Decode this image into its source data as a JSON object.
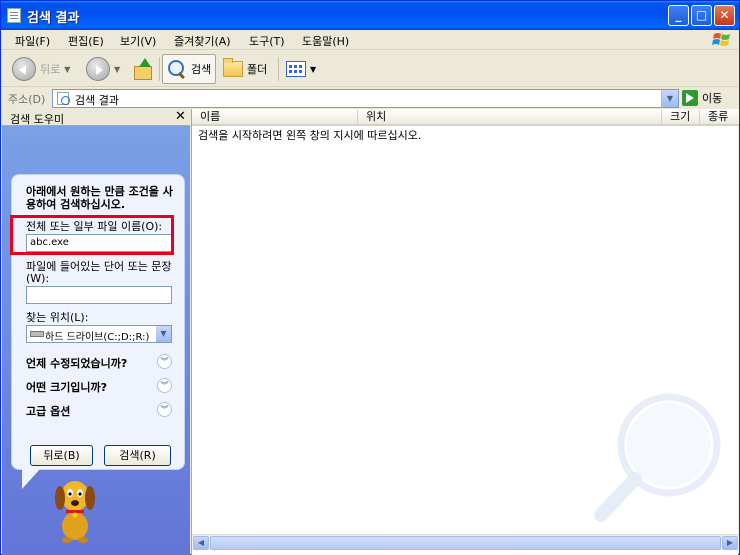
{
  "window": {
    "title": "검색 결과"
  },
  "menu": [
    "파일(F)",
    "편집(E)",
    "보기(V)",
    "즐겨찾기(A)",
    "도구(T)",
    "도움말(H)"
  ],
  "toolbar": {
    "back": "뒤로",
    "search": "검색",
    "folders": "폴더"
  },
  "address": {
    "label": "주소(D)",
    "value": "검색 결과",
    "go": "이동"
  },
  "left_pane": {
    "title": "검색 도우미",
    "close": "✕",
    "prompt": "아래에서 원하는 만큼 조건을 사용하여 검색하십시오.",
    "filename_label": "전체 또는 일부 파일 이름(O):",
    "filename_value": "abc.exe",
    "word_label": "파일에 들어있는 단어 또는 문장(W):",
    "word_value": "",
    "location_label": "찾는 위치(L):",
    "location_value": "하드 드라이브(C:;D:;R:)",
    "options": [
      "언제 수정되었습니까?",
      "어떤 크기입니까?",
      "고급 옵션"
    ],
    "back_button": "뒤로(B)",
    "search_button": "검색(R)"
  },
  "results": {
    "columns": [
      "이름",
      "위치",
      "크기",
      "종류"
    ],
    "message": "검색을 시작하려면 왼쪽 창의 지시에 따르십시오."
  }
}
